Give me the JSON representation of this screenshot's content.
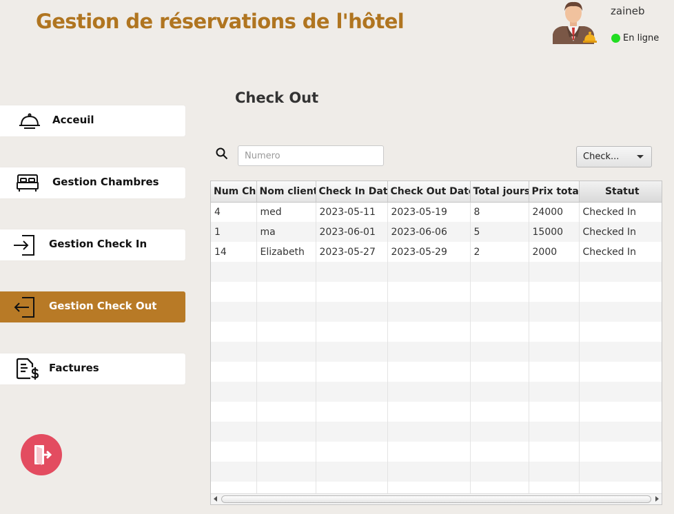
{
  "header": {
    "title": "Gestion de réservations de l'hôtel",
    "title_color": "#b07520"
  },
  "user": {
    "name": "zaineb",
    "status": "En ligne",
    "status_color": "#22dd22",
    "avatar_icon": "hotel-receptionist-icon"
  },
  "sidebar": {
    "accent": "#b87a26",
    "items": [
      {
        "label": "Acceuil",
        "icon": "cloche-icon",
        "active": false
      },
      {
        "label": "Gestion Chambres",
        "icon": "bed-icon",
        "active": false
      },
      {
        "label": "Gestion Check In",
        "icon": "login-icon",
        "active": false
      },
      {
        "label": "Gestion Check Out",
        "icon": "logout-arrow-icon",
        "active": true
      },
      {
        "label": "Factures",
        "icon": "invoice-icon",
        "active": false
      }
    ],
    "logout_icon": "exit-door-icon",
    "logout_color": "#e34c60"
  },
  "main": {
    "title": "Check Out",
    "search": {
      "placeholder": "Numero",
      "value": ""
    },
    "filter": {
      "selected": "Check..."
    },
    "table": {
      "columns": [
        "Num Ch",
        "Nom client",
        "Check In Date",
        "Check Out Date",
        "Total jours",
        "Prix total",
        "Statut"
      ],
      "rows": [
        [
          "4",
          "med",
          "2023-05-11",
          "2023-05-19",
          "8",
          "24000",
          "Checked In"
        ],
        [
          "1",
          "ma",
          "2023-06-01",
          "2023-06-06",
          "5",
          "15000",
          "Checked In"
        ],
        [
          "14",
          "Elizabeth",
          "2023-05-27",
          "2023-05-29",
          "2",
          "2000",
          "Checked In"
        ]
      ]
    }
  }
}
